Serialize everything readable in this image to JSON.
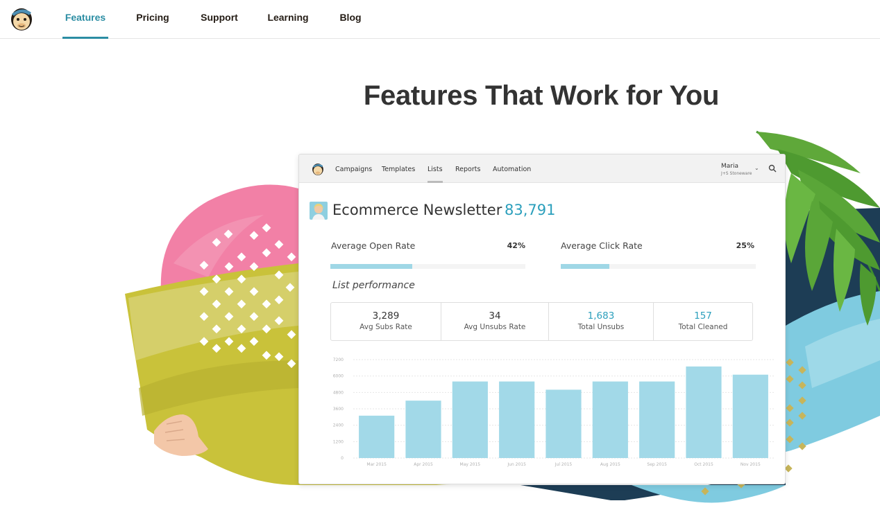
{
  "nav": {
    "items": [
      {
        "label": "Features",
        "active": true
      },
      {
        "label": "Pricing",
        "active": false
      },
      {
        "label": "Support",
        "active": false
      },
      {
        "label": "Learning",
        "active": false
      },
      {
        "label": "Blog",
        "active": false
      }
    ],
    "accent_color": "#2b8da3"
  },
  "hero": {
    "title": "Features That Work for You"
  },
  "card": {
    "nav_items": [
      "Campaigns",
      "Templates",
      "Lists",
      "Reports",
      "Automation"
    ],
    "active_nav": "Lists",
    "user": {
      "name": "Maria",
      "org": "J+S Stoneware"
    },
    "list": {
      "title": "Ecommerce Newsletter",
      "count": "83,791"
    },
    "rates": [
      {
        "label": "Average Open Rate",
        "value": "42%",
        "fraction": 0.42
      },
      {
        "label": "Average Click Rate",
        "value": "25%",
        "fraction": 0.25
      }
    ],
    "performance_title": "List performance",
    "stats": [
      {
        "value": "3,289",
        "label": "Avg Subs Rate",
        "highlight": false
      },
      {
        "value": "34",
        "label": "Avg Unsubs Rate",
        "highlight": false
      },
      {
        "value": "1,683",
        "label": "Total Unsubs",
        "highlight": true
      },
      {
        "value": "157",
        "label": "Total Cleaned",
        "highlight": true
      }
    ]
  },
  "chart_data": {
    "type": "bar",
    "categories": [
      "Mar 2015",
      "Apr 2015",
      "May 2015",
      "Jun 2015",
      "Jul 2015",
      "Aug 2015",
      "Sep 2015",
      "Oct 2015",
      "Nov 2015"
    ],
    "values": [
      3100,
      4200,
      5600,
      5600,
      5000,
      5600,
      5600,
      6700,
      6100
    ],
    "yticks": [
      "0",
      "1200",
      "2400",
      "3600",
      "4800",
      "6000",
      "7200"
    ],
    "ylim": [
      0,
      7200
    ],
    "bar_color": "#a2d9e8",
    "grid": true,
    "title": "",
    "xlabel": "",
    "ylabel": ""
  }
}
